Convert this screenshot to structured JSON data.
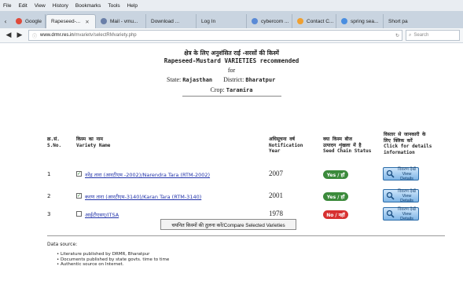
{
  "menu": [
    "File",
    "Edit",
    "View",
    "History",
    "Bookmarks",
    "Tools",
    "Help"
  ],
  "tabs": [
    {
      "label": "Google",
      "color": "#e04a3a",
      "active": false
    },
    {
      "label": "Rapeseed-...",
      "color": "#d7472e",
      "active": true
    },
    {
      "label": "Mail - vmu...",
      "color": "#6a7fa8",
      "active": false
    },
    {
      "label": "Download ...",
      "color": "#8d98a8",
      "active": false
    },
    {
      "label": "Log In",
      "color": "#8d98a8",
      "active": false
    },
    {
      "label": "cybercom ...",
      "color": "#5a8ad6",
      "active": false
    },
    {
      "label": "Contact C...",
      "color": "#f0a030",
      "active": false
    },
    {
      "label": "spring sea...",
      "color": "#4a8ee0",
      "active": false
    },
    {
      "label": "Short pa",
      "color": "#8d98a8",
      "active": false
    }
  ],
  "url": {
    "host": "www.drmr.res.in",
    "path": "/mvarietv/selectRMvariety.php"
  },
  "search_placeholder": "Search",
  "page": {
    "title_hindi": "क्षेत्र के लिए अनुशंसित राई -सरसों की किस्में",
    "title_english": "Rapeseed-Mustard VARIETIES recommended",
    "for_text": "for",
    "state_label": "State:",
    "state_value": "Rajasthan",
    "district_label": "District:",
    "district_value": "Bharatpur",
    "crop_label": "Crop:",
    "crop_value": "Taramira"
  },
  "table": {
    "headers": {
      "sno_hi": "क्र.सं.",
      "sno_en": "S.No.",
      "name_hi": "किस्म का नाम",
      "name_en": "Variety Name",
      "year_hi": "अधिसूचना वर्ष",
      "year_en1": "Notification",
      "year_en2": "Year",
      "seed_hi1": "क्या किस्म बीज",
      "seed_hi2": "उत्पादन शृंखला में है",
      "seed_en": "Seed Chain Status",
      "info_hi1": "विस्तार से जानकारी के",
      "info_hi2": "लिए क्लिक करें",
      "info_en1": "Click for details",
      "info_en2": "information"
    },
    "rows": [
      {
        "sno": "1",
        "checked": true,
        "name": "नरेंद्र तारा (आरटीएम -2002)/Narendra Tara (RTM-2002)",
        "year": "2007",
        "status": "Yes / हाँ",
        "status_type": "yes",
        "btn_hi": "विवरण देखें",
        "btn_en": "View Details"
      },
      {
        "sno": "2",
        "checked": true,
        "name": "करण तारा (आरटीएम-3140)/Karan Tara (RTM-3140)",
        "year": "2001",
        "status": "Yes / हाँ",
        "status_type": "yes",
        "btn_hi": "विवरण देखें",
        "btn_en": "View Details"
      },
      {
        "sno": "3",
        "checked": false,
        "name": "आईटीएसए/ITSA",
        "year": "1978",
        "status": "No / नहीं",
        "status_type": "no",
        "btn_hi": "विवरण देखें",
        "btn_en": "View Details"
      }
    ]
  },
  "compare_button": "चयनित किस्मों की तुलना करें/Compare Selected Varieties",
  "data_source": {
    "label": "Data source:",
    "items": [
      "Literature published by DRMR, Bharatpur",
      "Documents published by state govts. time to time",
      "Authentic source on Internet."
    ]
  },
  "colors": {
    "yes": "#3b8a3b",
    "no": "#d73030",
    "link": "#2233aa",
    "button": "#7fb5e6"
  }
}
